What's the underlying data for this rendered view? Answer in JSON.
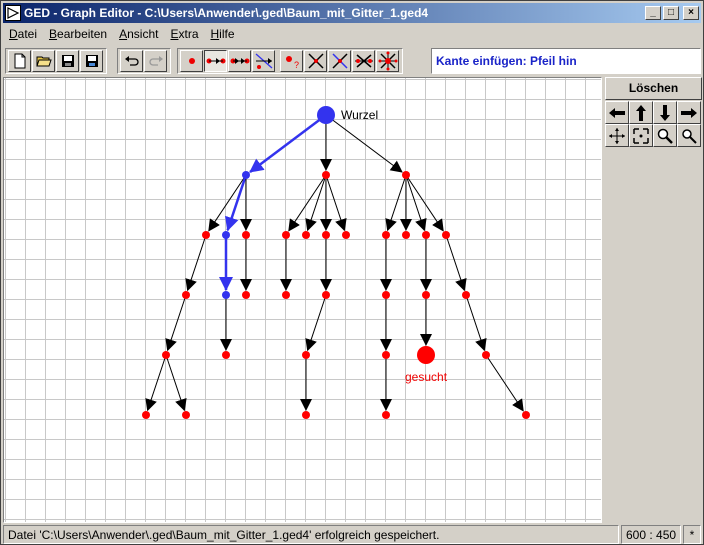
{
  "window": {
    "title": "GED - Graph Editor - C:\\Users\\Anwender\\.ged\\Baum_mit_Gitter_1.ged4",
    "controls": [
      "_",
      "□",
      "×"
    ]
  },
  "menubar": {
    "items": [
      {
        "ul": "D",
        "rest": "atei"
      },
      {
        "ul": "B",
        "rest": "earbeiten"
      },
      {
        "ul": "A",
        "rest": "nsicht"
      },
      {
        "ul": "E",
        "rest": "xtra"
      },
      {
        "ul": "H",
        "rest": "ilfe"
      }
    ]
  },
  "toolbar": {
    "file_buttons": [
      "new-file-icon",
      "open-folder-icon",
      "save-icon",
      "save-as-icon"
    ],
    "edit_buttons": [
      "undo-icon",
      "redo-icon"
    ],
    "mode_buttons": [
      "insert-node-icon",
      "insert-edge-icon",
      "insert-arrow-icon",
      "arrow-reverse-icon",
      "node-query-icon",
      "delete-edge-icon",
      "delete-edge-2-icon",
      "delete-node-icon",
      "delete-node-2-icon"
    ],
    "active_mode": "Kante einfügen: Pfeil hin"
  },
  "rightpanel": {
    "delete_label": "Löschen",
    "nav_icons": [
      "arrow-left-icon",
      "arrow-up-icon",
      "arrow-down-icon",
      "arrow-right-icon",
      "move-all-icon",
      "fit-icon",
      "zoom-in-icon",
      "zoom-out-icon"
    ]
  },
  "graph": {
    "root_label": "Wurzel",
    "goal_label": "gesucht",
    "colors": {
      "normal": "#ff0000",
      "highlight": "#3333ee",
      "edge": "#000000"
    }
  },
  "statusbar": {
    "message": "Datei 'C:\\Users\\Anwender\\.ged\\Baum_mit_Gitter_1.ged4' erfolgreich gespeichert.",
    "coords": "600 : 450",
    "modified": "*"
  }
}
